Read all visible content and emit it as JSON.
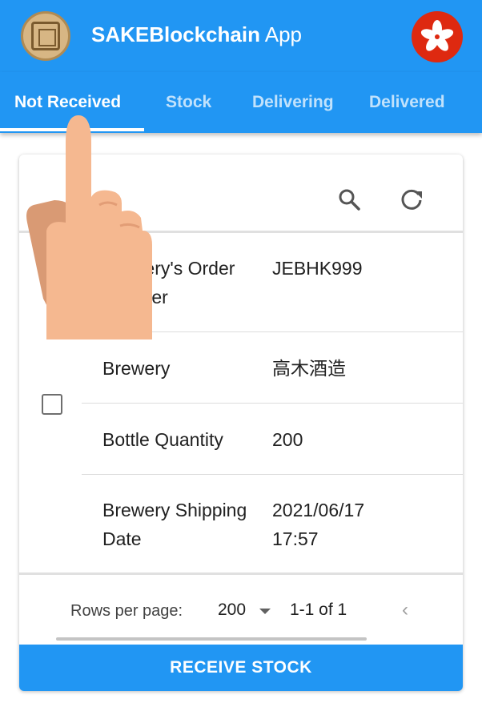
{
  "app": {
    "title_bold": "SAKEBlockchain",
    "title_rest": "App"
  },
  "tabs": [
    {
      "label": "Not Received",
      "active": true
    },
    {
      "label": "Stock",
      "active": false
    },
    {
      "label": "Delivering",
      "active": false
    },
    {
      "label": "Delivered",
      "active": false
    }
  ],
  "rows": [
    {
      "label": "Brewery's Order Number",
      "value": "JEBHK999"
    },
    {
      "label": "Brewery",
      "value": "高木酒造"
    },
    {
      "label": "Bottle Quantity",
      "value": "200"
    },
    {
      "label": "Brewery Shipping Date",
      "value": "2021/06/17 17:57"
    }
  ],
  "pagination": {
    "rows_per_page_label": "Rows per page:",
    "rows_per_page_value": "200",
    "range": "1-1 of 1"
  },
  "action_label": "RECEIVE STOCK",
  "colors": {
    "primary": "#2196f3",
    "flag_red": "#de2910"
  },
  "icons": [
    "app-logo",
    "hong-kong-flag-icon",
    "search-icon",
    "refresh-icon",
    "chevron-left-icon",
    "tap-hand-overlay"
  ]
}
